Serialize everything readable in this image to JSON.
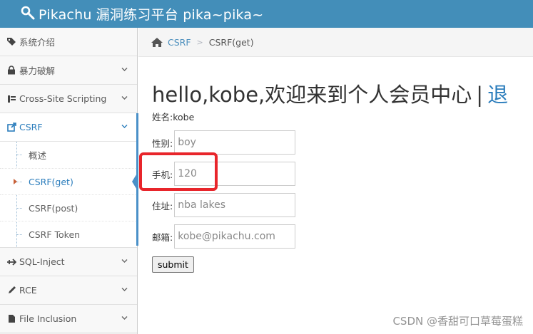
{
  "app": {
    "title": "Pikachu 漏洞练习平台 pika~pika~",
    "accent": "#438eb9"
  },
  "sidebar": {
    "items": [
      {
        "label": "系统介绍",
        "icon": "tag-icon"
      },
      {
        "label": "暴力破解",
        "icon": "lock-icon"
      },
      {
        "label": "Cross-Site Scripting",
        "icon": "sitemap-icon"
      },
      {
        "label": "CSRF",
        "icon": "share-icon"
      },
      {
        "label": "SQL-Inject",
        "icon": "plane-icon"
      },
      {
        "label": "RCE",
        "icon": "pencil-icon"
      },
      {
        "label": "File Inclusion",
        "icon": "file-icon"
      }
    ],
    "csrf_submenu": [
      {
        "label": "概述"
      },
      {
        "label": "CSRF(get)"
      },
      {
        "label": "CSRF(post)"
      },
      {
        "label": "CSRF Token"
      }
    ]
  },
  "breadcrumb": {
    "link": "CSRF",
    "separator": ">",
    "current": "CSRF(get)"
  },
  "main": {
    "welcome_text": "hello,kobe,欢迎来到个人会员中心",
    "separator": "|",
    "logout_label": "退",
    "username_line": "姓名:kobe",
    "fields": {
      "sex_label": "性别:",
      "sex_value": "boy",
      "phone_label": "手机:",
      "phone_value": "120",
      "address_label": "住址:",
      "address_value": "nba lakes",
      "email_label": "邮箱:",
      "email_value": "kobe@pikachu.com"
    },
    "submit_label": "submit"
  },
  "watermark": "CSDN @香甜可口草莓蛋糕"
}
